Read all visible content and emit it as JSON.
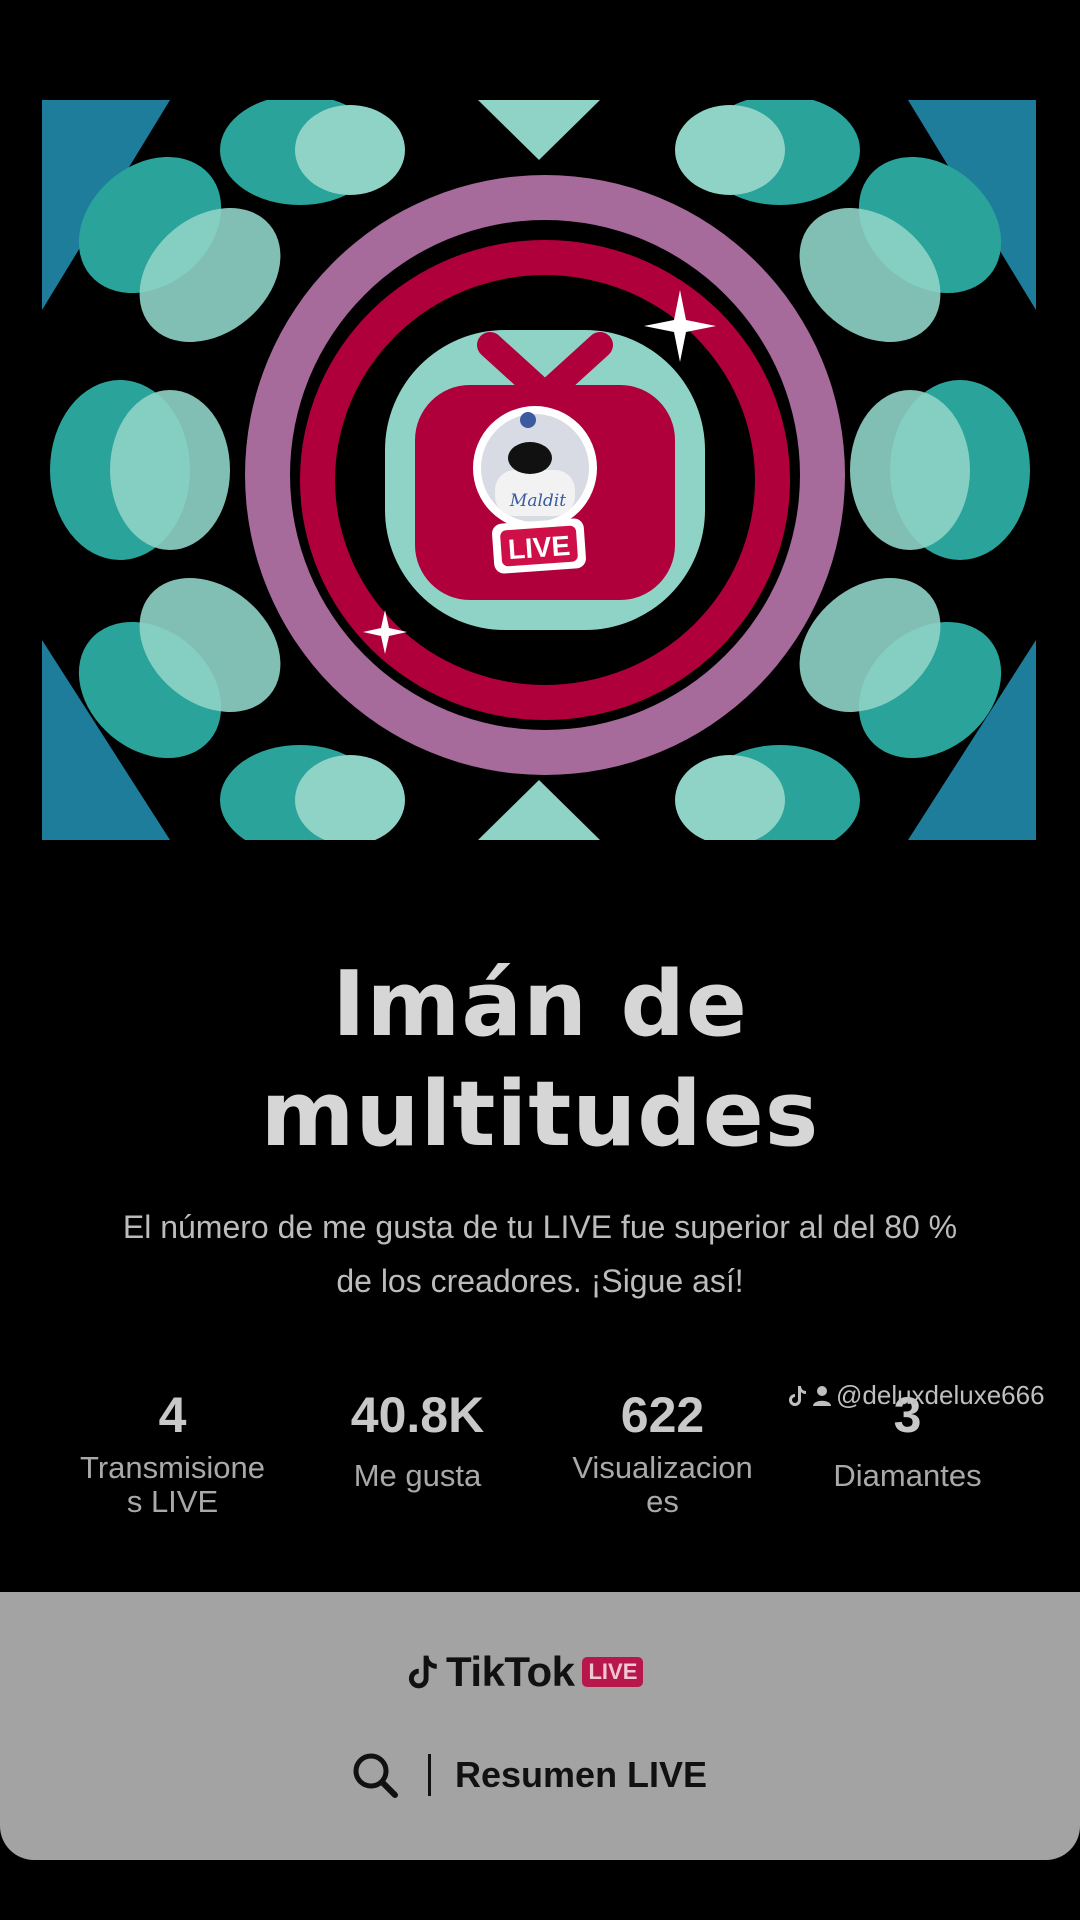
{
  "badge": {
    "live_label": "LIVE"
  },
  "achievement": {
    "title_line1": "Imán de",
    "title_line2": "multitudes",
    "description_line1": "El número de me gusta de tu LIVE fue superior al del 80 %",
    "description_line2": "de los creadores. ¡Sigue así!"
  },
  "stats": [
    {
      "value": "4",
      "label_line1": "Transmisione",
      "label_line2": "s LIVE"
    },
    {
      "value": "40.8K",
      "label_line1": "Me gusta",
      "label_line2": ""
    },
    {
      "value": "622",
      "label_line1": "Visualizacion",
      "label_line2": "es"
    },
    {
      "value": "3",
      "label_line1": "Diamantes",
      "label_line2": ""
    }
  ],
  "watermark": {
    "handle": "@deluxdeluxe666"
  },
  "footer": {
    "brand_name": "TikTok",
    "brand_badge": "LIVE",
    "summary_label": "Resumen LIVE"
  },
  "colors": {
    "teal": "#2aa39a",
    "mint": "#8fd3c7",
    "blue": "#1f7d9c",
    "pink_ring": "#a66a9b",
    "crimson": "#b0003b",
    "footer_bg": "#a3a3a3"
  }
}
